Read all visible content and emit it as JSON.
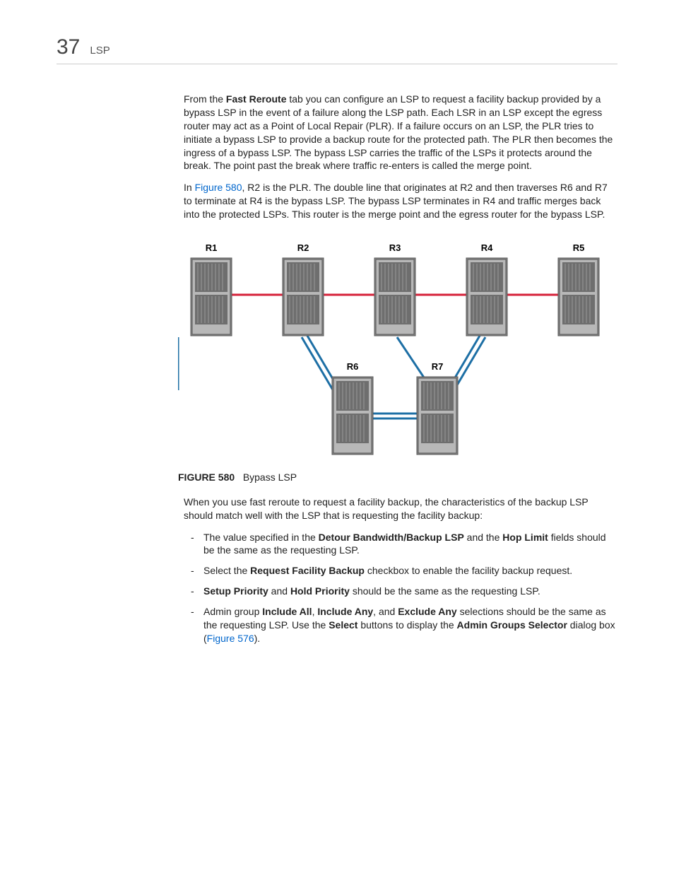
{
  "page_number": "37",
  "page_title": "LSP",
  "para1": {
    "pre": "From the ",
    "b1": "Fast Reroute",
    "post": " tab you can configure an LSP to request a facility backup provided by a bypass LSP in the event of a failure along the LSP path. Each LSR in an LSP except the egress router may act as a Point of Local Repair (PLR). If a failure occurs on an LSP, the PLR tries to initiate a bypass LSP to provide a backup route for the protected path. The PLR then becomes the ingress of a bypass LSP. The bypass LSP carries the traffic of the LSPs it protects around the break. The point past the break where traffic re-enters is called the merge point."
  },
  "para2": {
    "pre": "In ",
    "link": "Figure 580",
    "post": ", R2 is the PLR. The double line that originates at R2 and then traverses R6 and R7 to terminate at R4 is the bypass LSP. The bypass LSP terminates in R4 and traffic merges back into the protected LSPs. This router is the merge point and the egress router for the bypass LSP."
  },
  "diagram": {
    "top_labels": [
      "R1",
      "R2",
      "R3",
      "R4",
      "R5"
    ],
    "bottom_labels": [
      "R6",
      "R7"
    ]
  },
  "caption": {
    "label": "FIGURE 580",
    "text": "Bypass LSP"
  },
  "para3": "When you use fast reroute to request a facility backup, the characteristics of the backup LSP should match well with the LSP that is requesting the facility backup:",
  "bullets": {
    "b1": {
      "t1": "The value specified in the ",
      "b1": "Detour Bandwidth/Backup LSP",
      "t2": " and the ",
      "b2": "Hop Limit",
      "t3": " fields should be the same as the requesting LSP."
    },
    "b2": {
      "t1": "Select the ",
      "b1": "Request Facility Backup",
      "t2": " checkbox to enable the facility backup request."
    },
    "b3": {
      "b1": "Setup Priority",
      "t1": " and ",
      "b2": "Hold Priority",
      "t2": " should be the same as the requesting LSP."
    },
    "b4": {
      "t1": "Admin group ",
      "b1": "Include All",
      "t2": ", ",
      "b2": "Include Any",
      "t3": ", and ",
      "b3": "Exclude Any",
      "t4": " selections should be the same as the requesting LSP. Use the ",
      "b4": "Select",
      "t5": " buttons to display the ",
      "b5": "Admin Groups Selector",
      "t6": " dialog box (",
      "link": "Figure 576",
      "t7": ")."
    }
  }
}
